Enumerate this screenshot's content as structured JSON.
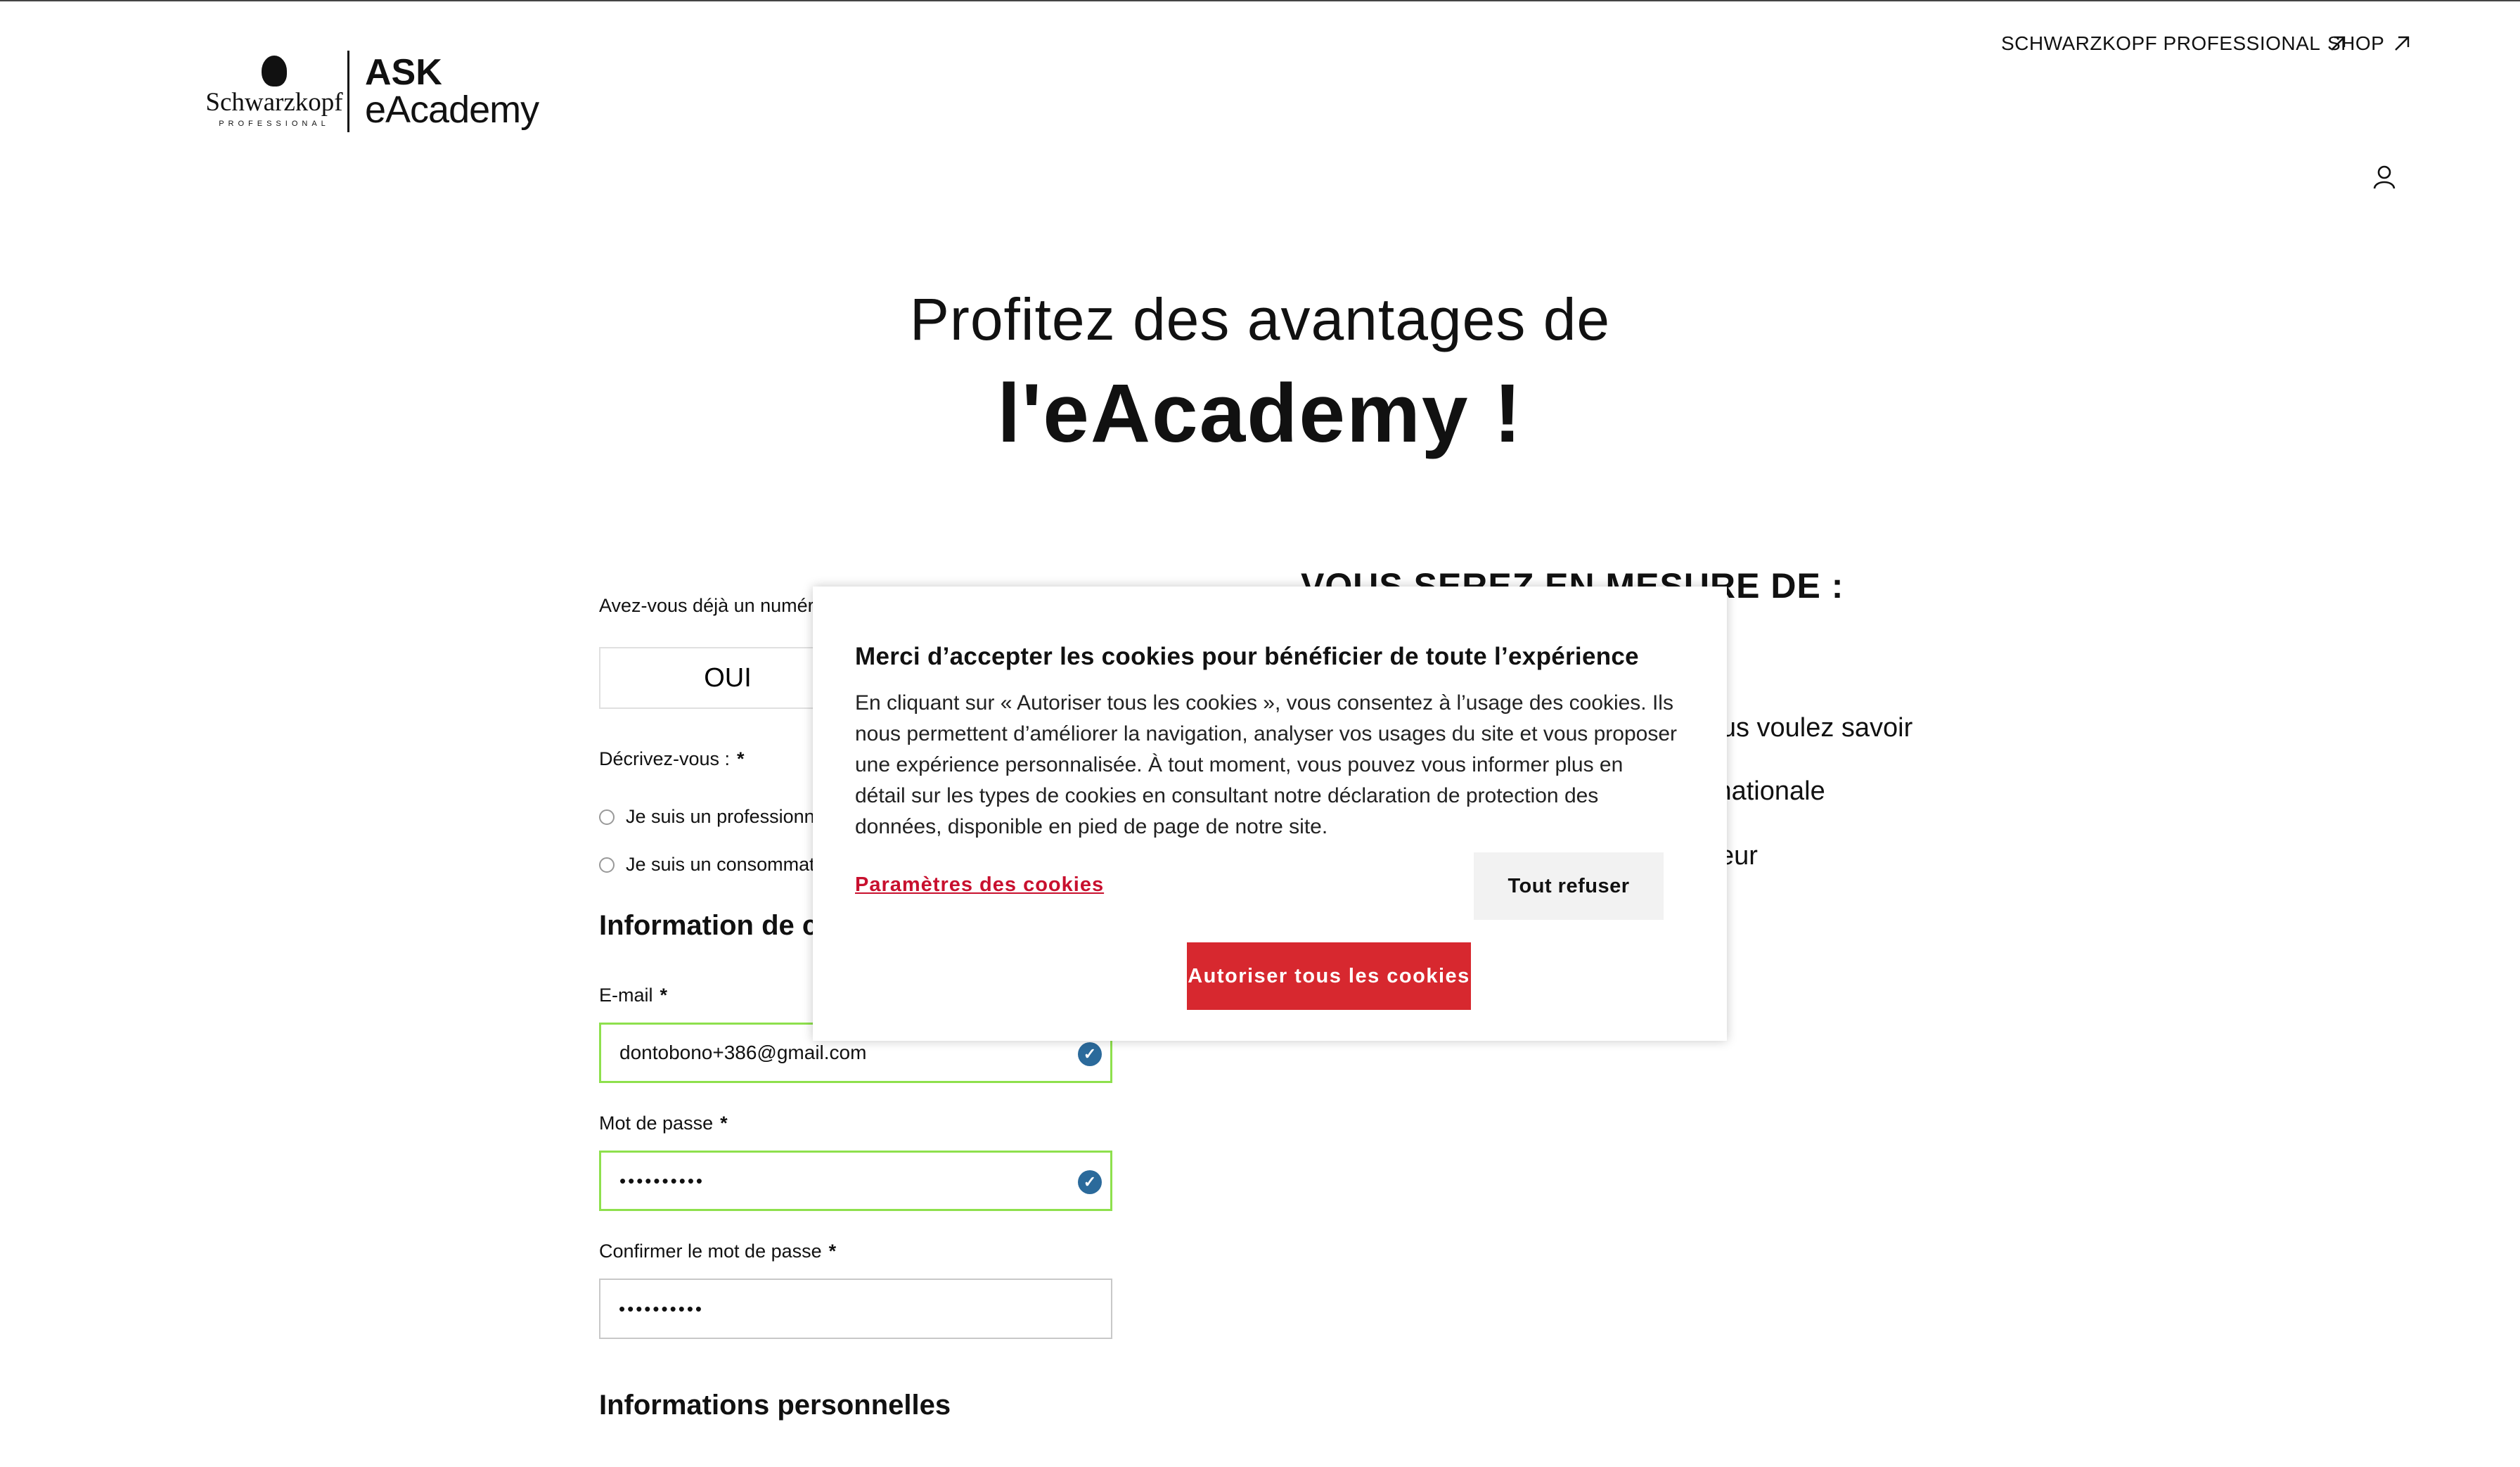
{
  "header": {
    "brand_name": "Schwarzkopf",
    "brand_sub": "PROFESSIONAL",
    "logo_ask": "ASK",
    "logo_eacademy": "eAcademy",
    "links": [
      {
        "label": "SCHWARZKOPF PROFESSIONAL",
        "icon": "external-arrow-icon"
      },
      {
        "label": "SHOP",
        "icon": "external-arrow-icon"
      }
    ],
    "account_icon": "user-icon"
  },
  "hero": {
    "line1": "Profitez des avantages de",
    "line2": "l'eAcademy !"
  },
  "right": {
    "title": "VOUS SEREZ EN MESURE DE :",
    "benefits": [
      "e vous voulez savoir",
      "nternationale",
      "coiffeur"
    ]
  },
  "form": {
    "question_label": "Avez-vous déjà un numéro de",
    "oui_label": "OUI",
    "describe_label": "Décrivez-vous :",
    "required_mark": "*",
    "radios": [
      {
        "label": "Je suis un professionnel",
        "checked": false
      },
      {
        "label": "Je suis un consommateur",
        "checked": false
      }
    ],
    "contact_section": "Information de con",
    "email_label": "E-mail",
    "email_value": "dontobono+386@gmail.com",
    "password_label": "Mot de passe",
    "password_value": "••••••••••",
    "confirm_label": "Confirmer le mot de passe",
    "confirm_value": "••••••••••",
    "personal_section": "Informations personnelles",
    "valid_icon": "check-circle-icon",
    "valid_color": "#8ee04d"
  },
  "cookie": {
    "title": "Merci d’accepter les cookies pour bénéficier de toute l’expérience",
    "body": "En cliquant sur « Autoriser tous les cookies », vous consentez à l’usage des cookies. Ils nous permettent d’améliorer la navigation, analyser vos usages du site et vous proposer une expérience personnalisée. À tout moment, vous pouvez vous informer plus en détail sur les types de cookies en consultant notre déclaration de protection des données, disponible en pied de page de notre site.",
    "settings_link": "Paramètres des cookies",
    "refuse_label": "Tout refuser",
    "accept_label": "Autoriser tous les cookies",
    "accent_color": "#d7282f"
  }
}
